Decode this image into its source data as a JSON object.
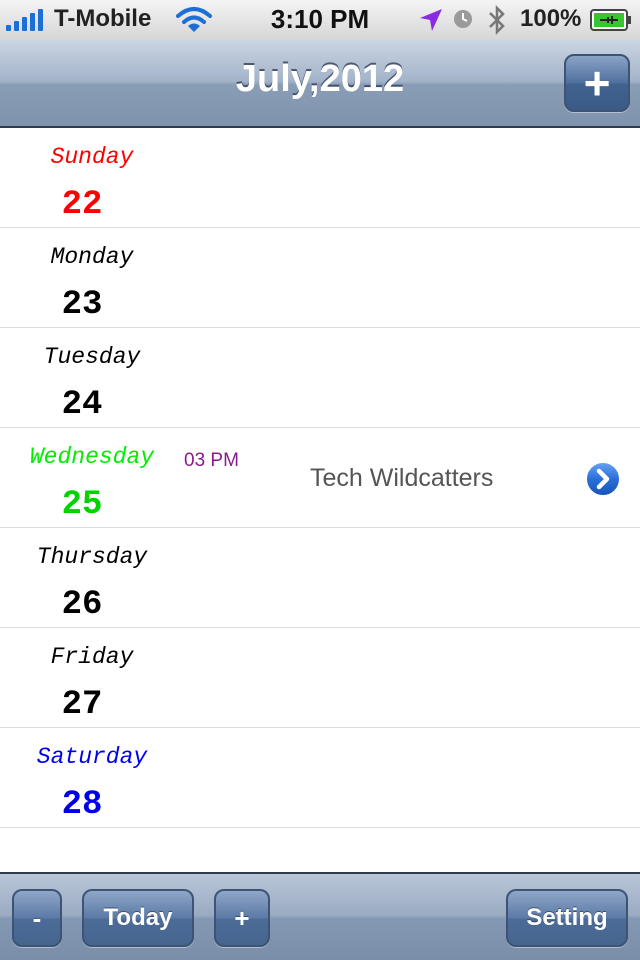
{
  "status_bar": {
    "carrier": "T-Mobile",
    "time": "3:10 PM",
    "battery_percent": "100%"
  },
  "nav_bar": {
    "title": "July,2012",
    "add_button": "+"
  },
  "days": [
    {
      "name": "Sunday",
      "number": "22",
      "color": "#ff0000"
    },
    {
      "name": "Monday",
      "number": "23",
      "color": "#000000"
    },
    {
      "name": "Tuesday",
      "number": "24",
      "color": "#000000"
    },
    {
      "name": "Wednesday",
      "number": "25",
      "color": "#00ee00",
      "event_time": "03 PM",
      "event_title": "Tech Wildcatters"
    },
    {
      "name": "Thursday",
      "number": "26",
      "color": "#000000"
    },
    {
      "name": "Friday",
      "number": "27",
      "color": "#000000"
    },
    {
      "name": "Saturday",
      "number": "28",
      "color": "#0000ee"
    }
  ],
  "toolbar": {
    "minus": "-",
    "today": "Today",
    "plus": "+",
    "setting": "Setting"
  },
  "colors": {
    "event_time": "#8b1a8b",
    "nav_accent": "#41628f"
  },
  "icons": [
    "signal-bars-icon",
    "wifi-icon",
    "location-arrow-icon",
    "alarm-clock-icon",
    "bluetooth-icon",
    "battery-icon",
    "disclosure-arrow-icon"
  ]
}
